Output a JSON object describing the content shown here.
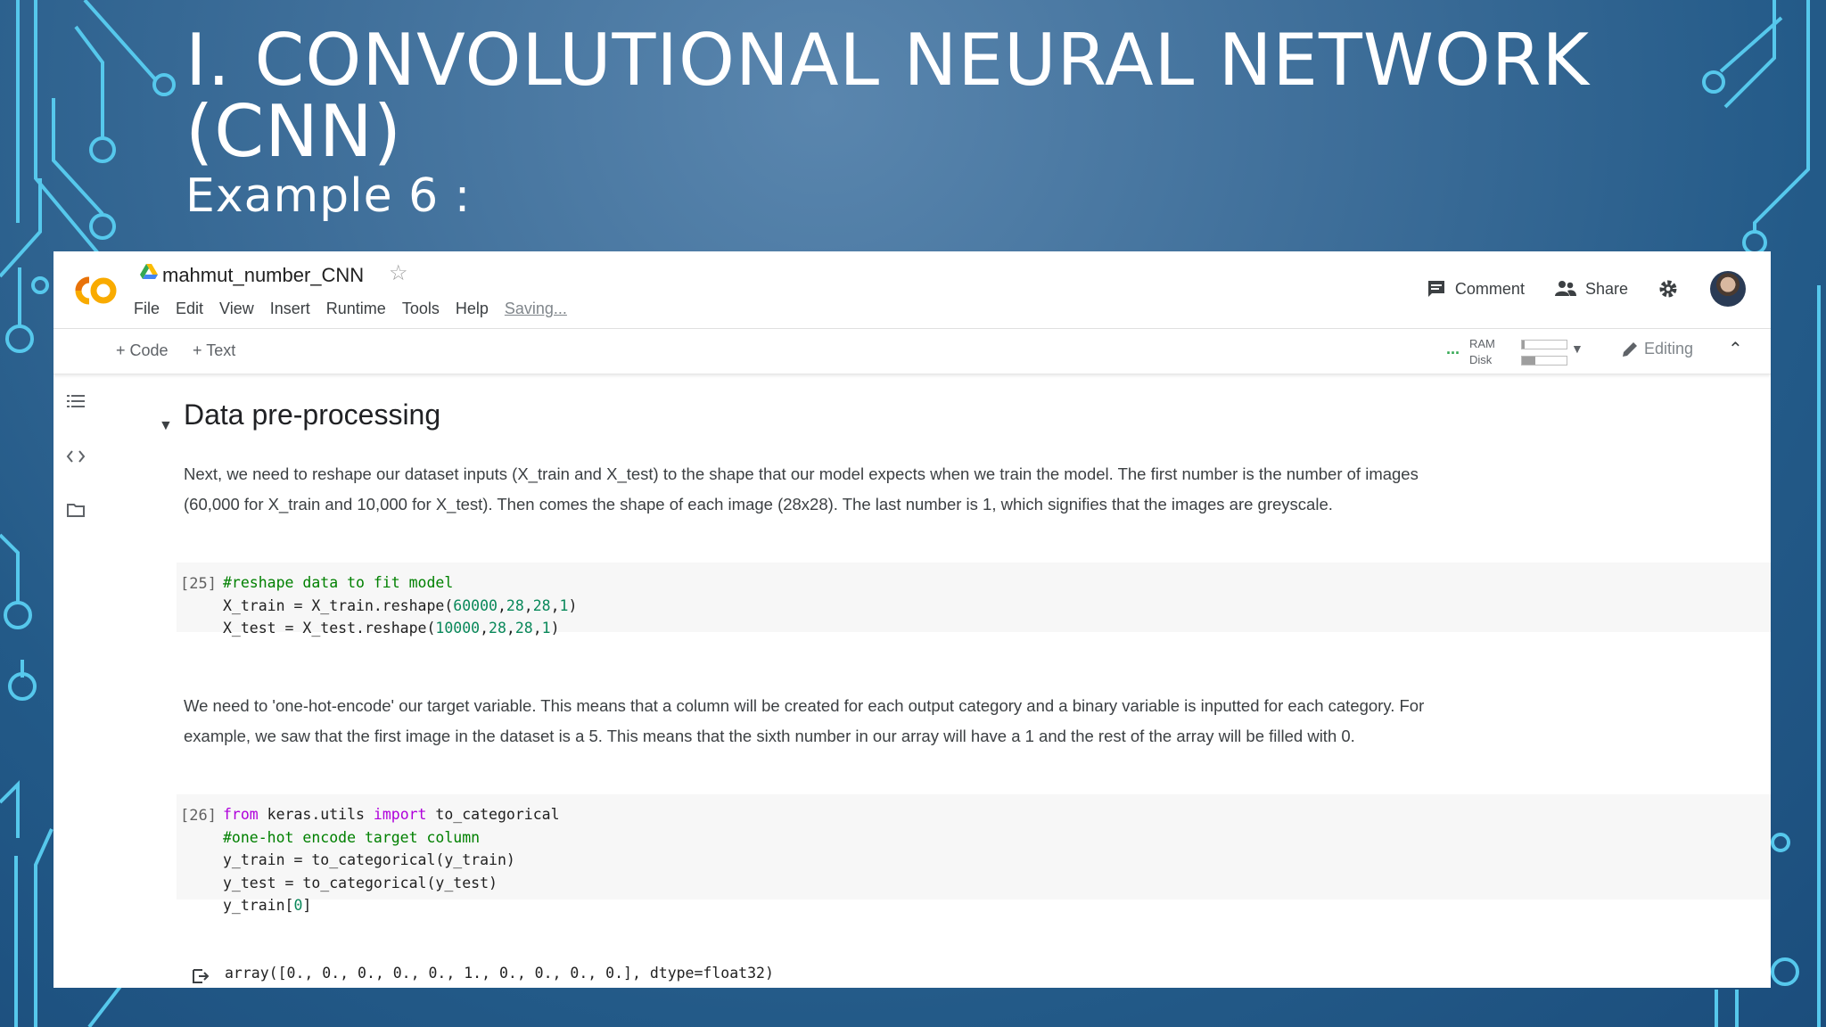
{
  "slide": {
    "title": "I. CONVOLUTIONAL NEURAL NETWORK (CNN)",
    "subtitle": "Example 6 :"
  },
  "colab": {
    "logo_text": "CO",
    "notebook_title": "mahmut_number_CNN",
    "menu": [
      "File",
      "Edit",
      "View",
      "Insert",
      "Runtime",
      "Tools",
      "Help"
    ],
    "saving_status": "Saving...",
    "header_buttons": {
      "comment": "Comment",
      "share": "Share"
    },
    "toolbar": {
      "add_code": "+ Code",
      "add_text": "+ Text",
      "ram_label": "RAM",
      "disk_label": "Disk",
      "ram_usage": 0.05,
      "disk_usage": 0.3,
      "editing": "Editing"
    },
    "section": {
      "heading": "Data pre-processing",
      "para1": "Next, we need to reshape our dataset inputs (X_train and X_test) to the shape that our model expects when we train the model. The first number is the number of images (60,000 for X_train and 10,000 for X_test). Then comes the shape of each image (28x28). The last number is 1, which signifies that the images are greyscale.",
      "cell25": {
        "prompt": "[25]",
        "lines": [
          [
            {
              "t": "c",
              "v": "#reshape data to fit model"
            }
          ],
          [
            {
              "t": "p",
              "v": "X_train = X_train.reshape("
            },
            {
              "t": "n",
              "v": "60000"
            },
            {
              "t": "p",
              "v": ","
            },
            {
              "t": "n",
              "v": "28"
            },
            {
              "t": "p",
              "v": ","
            },
            {
              "t": "n",
              "v": "28"
            },
            {
              "t": "p",
              "v": ","
            },
            {
              "t": "n",
              "v": "1"
            },
            {
              "t": "p",
              "v": ")"
            }
          ],
          [
            {
              "t": "p",
              "v": "X_test = X_test.reshape("
            },
            {
              "t": "n",
              "v": "10000"
            },
            {
              "t": "p",
              "v": ","
            },
            {
              "t": "n",
              "v": "28"
            },
            {
              "t": "p",
              "v": ","
            },
            {
              "t": "n",
              "v": "28"
            },
            {
              "t": "p",
              "v": ","
            },
            {
              "t": "n",
              "v": "1"
            },
            {
              "t": "p",
              "v": ")"
            }
          ]
        ]
      },
      "para2": "We need to 'one-hot-encode' our target variable. This means that a column will be created for each output category and a binary variable is inputted for each category. For example, we saw that the first image in the dataset is a 5. This means that the sixth number in our array will have a 1 and the rest of the array will be filled with 0.",
      "cell26": {
        "prompt": "[26]",
        "lines": [
          [
            {
              "t": "k",
              "v": "from"
            },
            {
              "t": "p",
              "v": " keras.utils "
            },
            {
              "t": "k",
              "v": "import"
            },
            {
              "t": "p",
              "v": " to_categorical"
            }
          ],
          [
            {
              "t": "c",
              "v": "#one-hot encode target column"
            }
          ],
          [
            {
              "t": "p",
              "v": "y_train = to_categorical(y_train)"
            }
          ],
          [
            {
              "t": "p",
              "v": "y_test = to_categorical(y_test)"
            }
          ],
          [
            {
              "t": "p",
              "v": "y_train["
            },
            {
              "t": "n",
              "v": "0"
            },
            {
              "t": "p",
              "v": "]"
            }
          ]
        ],
        "output": "array([0., 0., 0., 0., 0., 1., 0., 0., 0., 0.], dtype=float32)"
      }
    }
  }
}
